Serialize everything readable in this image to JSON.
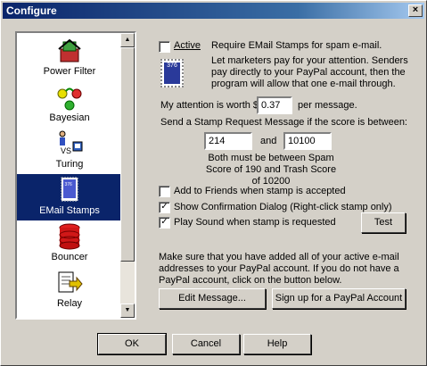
{
  "window": {
    "title": "Configure",
    "close_glyph": "×"
  },
  "sidebar": {
    "items": [
      {
        "label": "Power Filter",
        "icon": "power-filter-icon",
        "selected": false
      },
      {
        "label": "Bayesian",
        "icon": "bayesian-icon",
        "selected": false
      },
      {
        "label": "Turing",
        "icon": "turing-icon",
        "selected": false
      },
      {
        "label": "EMail Stamps",
        "icon": "email-stamp-icon",
        "selected": true
      },
      {
        "label": "Bouncer",
        "icon": "bouncer-icon",
        "selected": false
      },
      {
        "label": "Relay",
        "icon": "relay-icon",
        "selected": false
      }
    ],
    "stamp_value_text": "376",
    "turing_vs_text": "VS"
  },
  "main": {
    "active_label": "Active",
    "active_checked": false,
    "require_text": "Require EMail Stamps for spam e-mail.",
    "intro_text": "Let marketers pay for your attention.  Senders pay directly to your PayPal account, then the program will allow that one e-mail through.",
    "stamp_value_text": "376",
    "attention_prefix": "My attention is worth $",
    "attention_value": "0.37",
    "attention_suffix": "per message.",
    "score_range_text": "Send a Stamp Request Message if the score is between:",
    "score_low": "214",
    "score_and": "and",
    "score_high": "10100",
    "range_note": "Both must be between Spam Score of 190 and Trash Score of 10200",
    "add_friends_label": "Add to Friends when stamp is accepted",
    "add_friends_checked": false,
    "show_confirm_label": "Show Confirmation Dialog (Right-click stamp only)",
    "show_confirm_checked": true,
    "play_sound_label": "Play Sound when stamp is requested",
    "play_sound_checked": true,
    "test_label": "Test",
    "paypal_note": "Make sure that you have added all of your active e-mail addresses to your PayPal account.  If you do not have a PayPal account, click on the button below.",
    "edit_message_label": "Edit Message...",
    "signup_label": "Sign up for a PayPal Account",
    "check_glyph": "✓"
  },
  "footer": {
    "ok_label": "OK",
    "cancel_label": "Cancel",
    "help_label": "Help"
  },
  "colors": {
    "selection": "#0a246a",
    "face": "#d4d0c8"
  }
}
